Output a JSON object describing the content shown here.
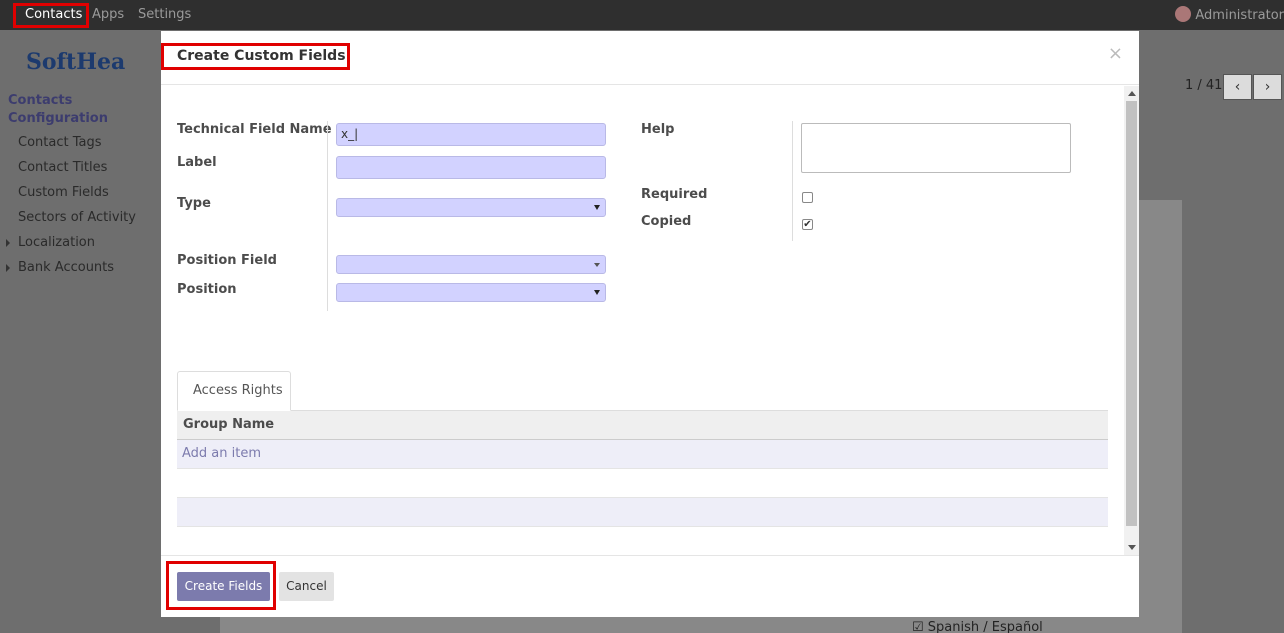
{
  "navbar": {
    "menu": [
      "Contacts",
      "Apps",
      "Settings"
    ],
    "user": "Administrator"
  },
  "background": {
    "logo": "SoftHea",
    "sidebar": {
      "sections": [
        "Contacts",
        "Configuration"
      ],
      "items": [
        "Contact Tags",
        "Contact Titles",
        "Custom Fields",
        "Sectors of Activity",
        "Localization",
        "Bank Accounts"
      ]
    },
    "pager": "1 / 41",
    "pager_prev": "‹",
    "pager_next": "›",
    "language": "Spanish / Español"
  },
  "modal": {
    "title": "Create Custom Fields",
    "close": "×",
    "fields": {
      "technical_name": {
        "label": "Technical Field Name",
        "value": "x_|"
      },
      "label": {
        "label": "Label",
        "value": ""
      },
      "type": {
        "label": "Type",
        "value": ""
      },
      "position_field": {
        "label": "Position Field",
        "value": ""
      },
      "position": {
        "label": "Position",
        "value": ""
      },
      "help": {
        "label": "Help",
        "value": ""
      },
      "required": {
        "label": "Required",
        "checked": false
      },
      "copied": {
        "label": "Copied",
        "checked": true,
        "mark": "✔"
      }
    },
    "tab": "Access Rights",
    "table": {
      "column": "Group Name",
      "add_item": "Add an item"
    },
    "buttons": {
      "create": "Create Fields",
      "cancel": "Cancel"
    }
  },
  "colors": {
    "navbar": "#2f2f2f",
    "primary": "#7c7bad",
    "input_bg": "#d2d2ff",
    "highlight": "#e00000"
  }
}
